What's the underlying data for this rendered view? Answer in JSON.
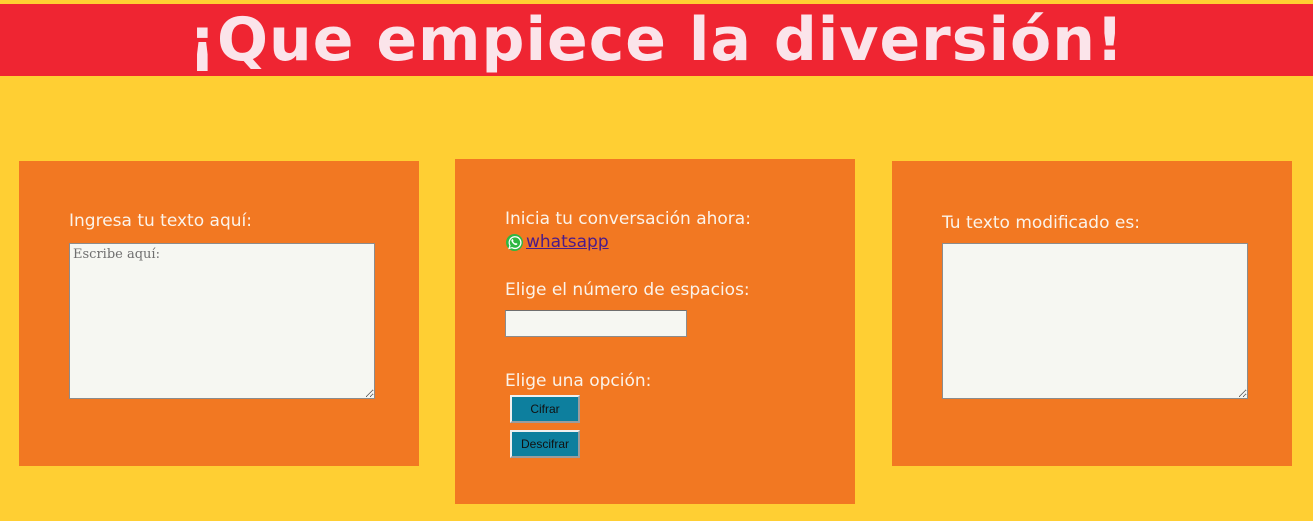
{
  "header": {
    "title": "¡Que empiece la diversión!"
  },
  "input_panel": {
    "label": "Ingresa tu texto aquí:",
    "textarea_placeholder": "Escribe aquí:",
    "textarea_value": ""
  },
  "controls_panel": {
    "conversation_label": "Inicia tu conversación ahora:",
    "whatsapp_link": "whatsapp",
    "spaces_label": "Elige el número de espacios:",
    "spaces_value": "",
    "option_label": "Elige una opción:",
    "cipher_button": "Cifrar",
    "decipher_button": "Descifrar"
  },
  "output_panel": {
    "label": "Tu texto modificado es:",
    "textarea_value": ""
  },
  "colors": {
    "background": "#ffcf33",
    "banner": "#ef2532",
    "panel": "#f27822",
    "button": "#0d7f9e",
    "link": "#4b1b8a"
  },
  "icons": {
    "whatsapp": "whatsapp-icon"
  }
}
